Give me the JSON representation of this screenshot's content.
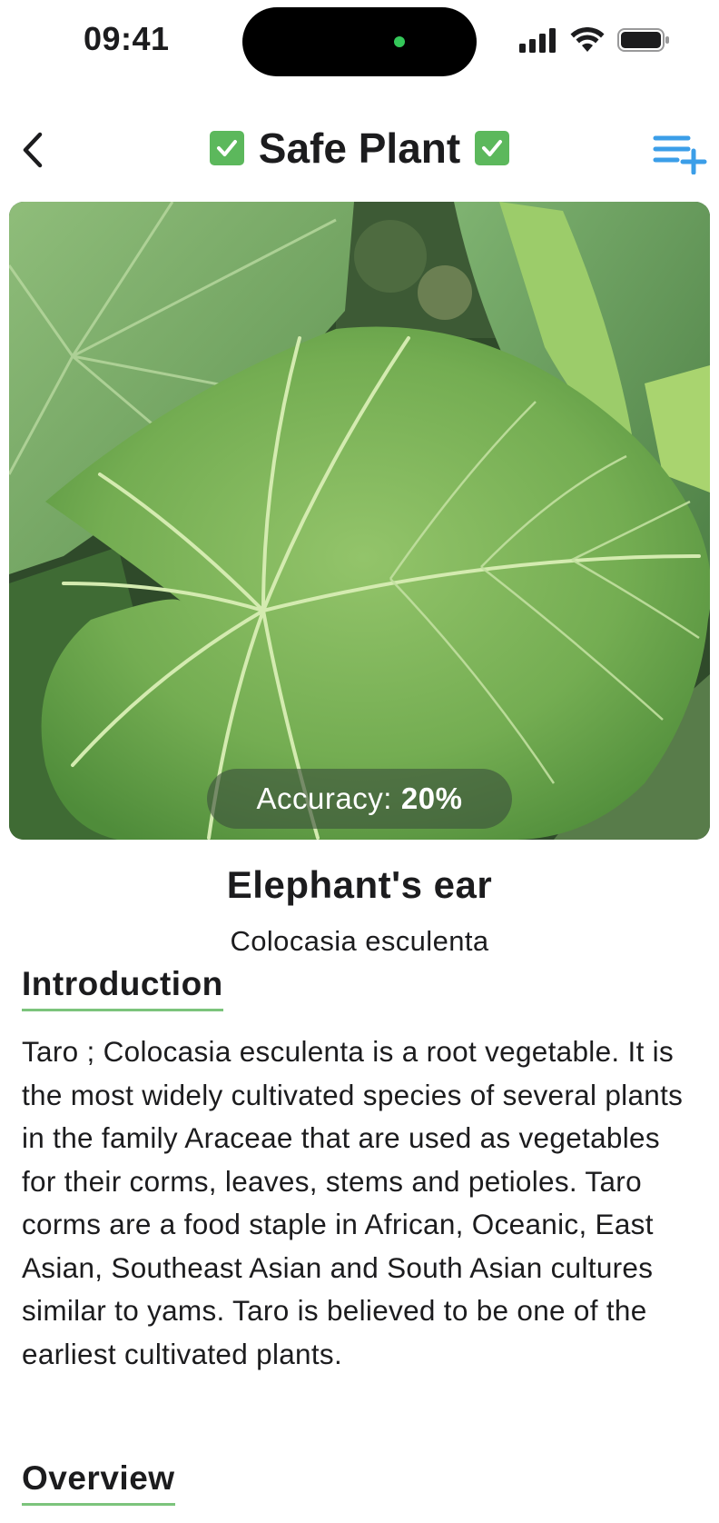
{
  "status_bar": {
    "time": "09:41"
  },
  "nav": {
    "title": "Safe Plant"
  },
  "hero": {
    "accuracy_label": "Accuracy:",
    "accuracy_value": "20%"
  },
  "plant": {
    "common_name": "Elephant's ear",
    "scientific_name": "Colocasia esculenta"
  },
  "sections": {
    "introduction_title": "Introduction",
    "introduction_text": "Taro ; Colocasia esculenta is a root vegetable. It is the most widely cultivated species of several plants in the family Araceae that are used as vegetables for their corms, leaves, stems and petioles. Taro corms are a food staple in African, Oceanic, East Asian, Southeast Asian and South Asian cultures similar to yams. Taro is believed to be one of the earliest cultivated plants.",
    "overview_title": "Overview"
  },
  "colors": {
    "accent_blue": "#3b9ee8",
    "safe_green": "#5cb85c",
    "underline_green": "#7cc47c"
  }
}
